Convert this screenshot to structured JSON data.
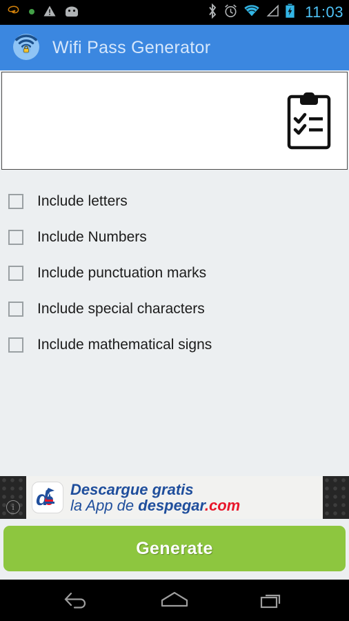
{
  "status_bar": {
    "time": "11:03",
    "left_icons": [
      {
        "name": "orange-swirl-icon",
        "label": "notification"
      },
      {
        "name": "green-dot-icon",
        "label": "notification"
      },
      {
        "name": "warning-triangle-icon",
        "label": "warning"
      },
      {
        "name": "android-face-icon",
        "label": "android"
      }
    ],
    "right_icons": [
      {
        "name": "bluetooth-icon",
        "label": "bluetooth"
      },
      {
        "name": "alarm-clock-icon",
        "label": "alarm"
      },
      {
        "name": "wifi-icon",
        "label": "wifi"
      },
      {
        "name": "signal-icon",
        "label": "cell-signal"
      },
      {
        "name": "battery-charging-icon",
        "label": "battery charging"
      }
    ],
    "colors": {
      "background": "#000000",
      "clock": "#4fc3f7",
      "wifi": "#33b5e5",
      "battery": "#33b5e5",
      "icon_gray": "#9e9e9e"
    }
  },
  "app_bar": {
    "title": "Wifi Pass Generator",
    "icon": "wifi-lock-icon",
    "background_color": "#3b87e0",
    "title_color": "#d6e7fb"
  },
  "result_card": {
    "value": "",
    "placeholder": "",
    "icon": "clipboard-checklist-icon",
    "background_color": "#ffffff",
    "border_color": "#4a4a4a"
  },
  "options": [
    {
      "label": "Include letters",
      "checked": false,
      "name": "checkbox-include-letters"
    },
    {
      "label": "Include Numbers",
      "checked": false,
      "name": "checkbox-include-numbers"
    },
    {
      "label": "Include punctuation marks",
      "checked": false,
      "name": "checkbox-include-punctuation"
    },
    {
      "label": "Include special characters",
      "checked": false,
      "name": "checkbox-include-special"
    },
    {
      "label": "Include mathematical signs",
      "checked": false,
      "name": "checkbox-include-math"
    }
  ],
  "ad": {
    "line1": "Descargue gratis",
    "line2_light": "la App de ",
    "line2_bold": "despegar",
    "line2_com": ".com",
    "logo_letter": "d",
    "info_glyph": "i",
    "colors": {
      "blue": "#1f4e9c",
      "red": "#e8162a",
      "background": "#f2f2f0",
      "edge": "#262626"
    }
  },
  "generate_button": {
    "label": "Generate",
    "background_color": "#8dc63f",
    "text_color": "#ffffff"
  },
  "nav_bar": {
    "buttons": [
      {
        "name": "nav-back-button",
        "label": "Back"
      },
      {
        "name": "nav-home-button",
        "label": "Home"
      },
      {
        "name": "nav-recents-button",
        "label": "Recent apps"
      }
    ],
    "background_color": "#000000",
    "icon_color": "#9e9e9e"
  },
  "page": {
    "background_color": "#eceff1"
  }
}
